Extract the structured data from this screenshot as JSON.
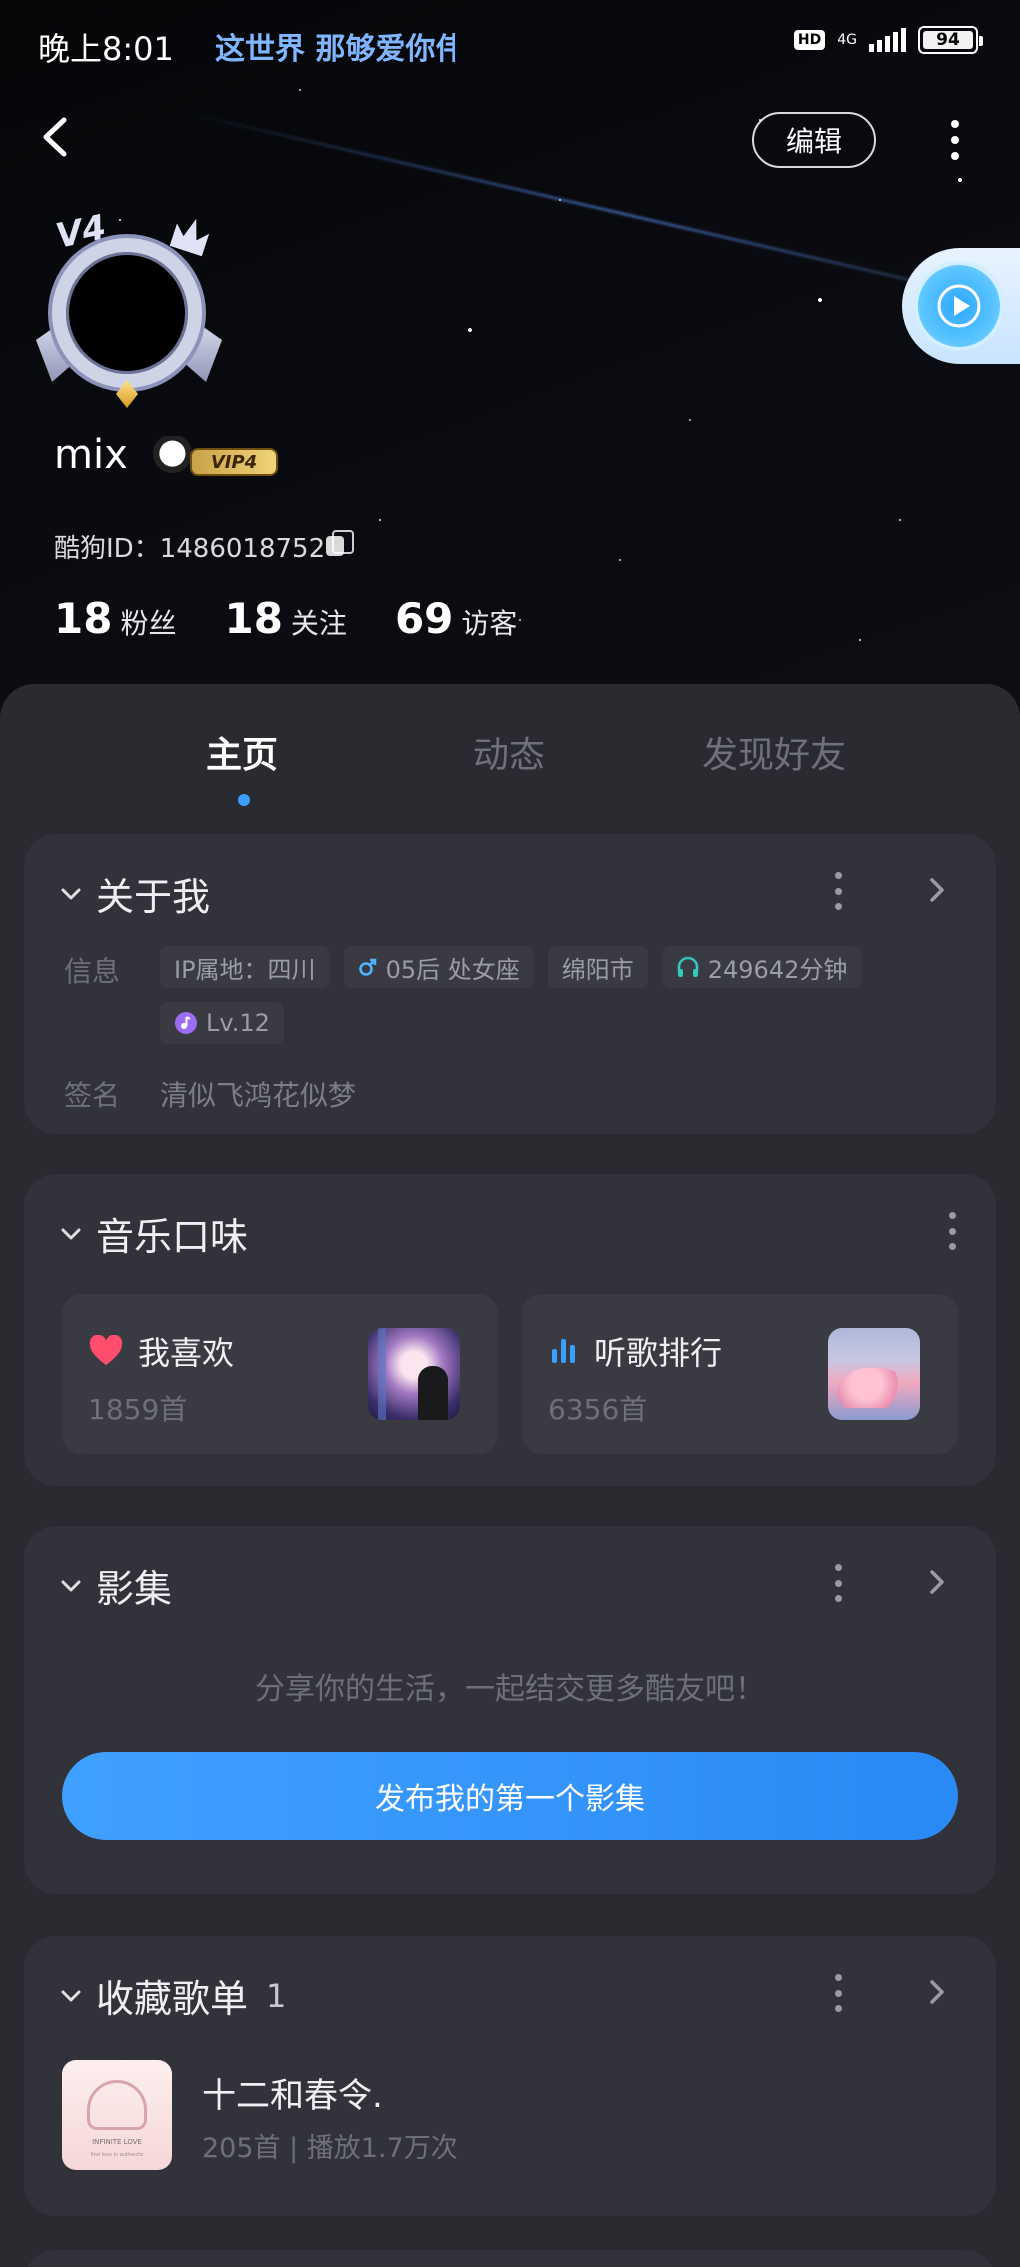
{
  "status_bar": {
    "time": "晚上8:01",
    "marquee": "这世界 那够爱你伟",
    "hd": "HD",
    "network": "4G",
    "battery": "94"
  },
  "header": {
    "edit_label": "编辑",
    "avatar_level": "V4"
  },
  "profile": {
    "username": "mix",
    "vip_label": "VIP4",
    "id_text": "酷狗ID：1486018752",
    "stats": [
      {
        "num": "18",
        "label": "粉丝"
      },
      {
        "num": "18",
        "label": "关注"
      },
      {
        "num": "69",
        "label": "访客"
      }
    ]
  },
  "tabs": [
    "主页",
    "动态",
    "发现好友"
  ],
  "about": {
    "title": "关于我",
    "info_label": "信息",
    "tags": [
      "IP属地：四川",
      "05后  处女座",
      "绵阳市",
      "249642分钟",
      "Lv.12"
    ],
    "signature_label": "签名",
    "signature": "清似飞鸿花似梦"
  },
  "music": {
    "title": "音乐口味",
    "liked_title": "我喜欢",
    "liked_count": "1859首",
    "rank_title": "听歌排行",
    "rank_count": "6356首"
  },
  "album": {
    "title": "影集",
    "empty_text": "分享你的生活，一起结交更多酷友吧！",
    "publish_label": "发布我的第一个影集"
  },
  "playlists": {
    "title": "收藏歌单",
    "count": "1",
    "item_title": "十二和春令.",
    "item_meta": "205首  |  播放1.7万次",
    "cover_text": "INFINITE LOVE",
    "cover_sub": "find love in authentic"
  },
  "colors": {
    "accent": "#3d9cff",
    "male": "#4fb3ff",
    "headphone": "#2fc7c2",
    "level": "#9b6cf5",
    "heart": "#ff4d6d",
    "rank": "#3aa0ff"
  }
}
